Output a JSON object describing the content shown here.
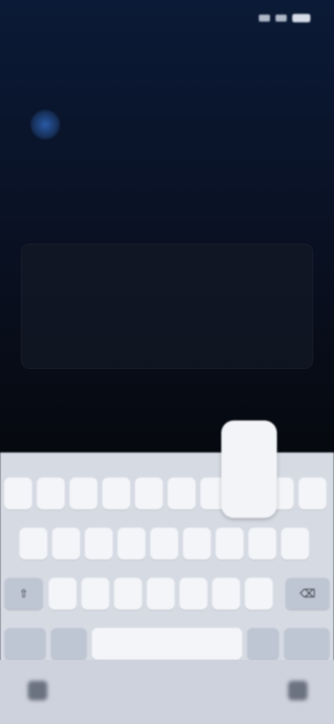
{
  "status_bar": {
    "time": "",
    "icons": [
      "signal-icon",
      "wifi-icon",
      "battery-icon"
    ]
  },
  "page": {
    "section_title": "",
    "heading": "",
    "subtext": "",
    "input_placeholder": ""
  },
  "keyboard": {
    "preview_char": "",
    "rows": [
      [
        "",
        "",
        "",
        "",
        "",
        "",
        "",
        "",
        "",
        ""
      ],
      [
        "",
        "",
        "",
        "",
        "",
        "",
        "",
        "",
        ""
      ],
      [
        "⇧",
        "",
        "",
        "",
        "",
        "",
        "",
        "",
        "⌫"
      ],
      [
        "",
        "",
        "",
        "",
        ""
      ]
    ]
  },
  "nav": {
    "left_icon": "keyboard-hide-icon",
    "right_icon": "keyboard-switch-icon"
  },
  "colors": {
    "background_top": "#0b1a36",
    "background_bottom": "#05070b",
    "keyboard_bg": "#d6dae3",
    "key_bg": "#f3f5f9",
    "func_key_bg": "#bfc6d3"
  }
}
